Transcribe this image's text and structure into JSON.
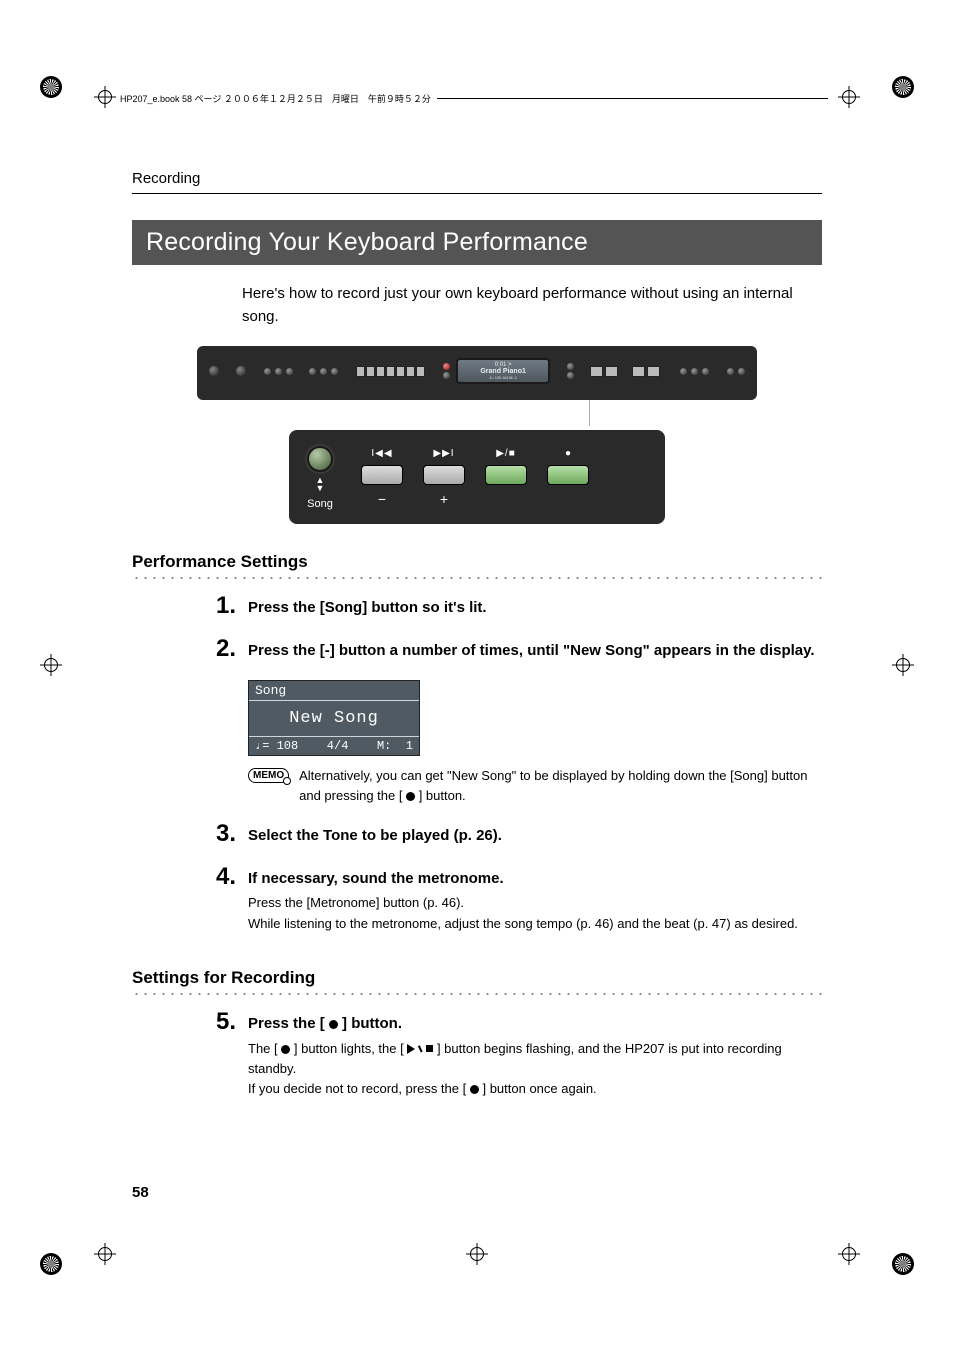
{
  "bookbar": {
    "info": "HP207_e.book 58 ページ ２００６年１２月２５日　月曜日　午前９時５２分"
  },
  "running_head": "Recording",
  "section_title": "Recording Your Keyboard Performance",
  "intro": "Here's how to record just your own keyboard performance without using an internal song.",
  "device": {
    "screen_line1": "0:01   >",
    "screen_line2": "Grand Piano1",
    "screen_line3": "J= 120       4/4   M:     1",
    "song_label": "Song"
  },
  "sub1": "Performance Settings",
  "steps_a": [
    {
      "n": "1",
      "title": "Press the [Song] button so it's lit."
    },
    {
      "n": "2",
      "title": "Press the [-] button a number of times, until \"New Song\" appears in the display."
    }
  ],
  "lcd": {
    "top": "Song",
    "mid": "New Song",
    "tempo": "♩= 108",
    "sig": "4/4",
    "meas_lbl": "M:",
    "meas": "1"
  },
  "memo": {
    "badge": "MEMO",
    "text_a": "Alternatively, you can get \"New Song\" to be displayed by holding down the [Song] button and pressing the [ ",
    "text_b": " ] button."
  },
  "steps_b": [
    {
      "n": "3",
      "title": "Select the Tone to be played (p. 26)."
    },
    {
      "n": "4",
      "title": "If necessary, sound the metronome.",
      "detail_a": "Press the [Metronome] button (p. 46).",
      "detail_b": "While listening to the metronome, adjust the song tempo (p. 46) and the beat (p. 47) as desired."
    }
  ],
  "sub2": "Settings for Recording",
  "step5": {
    "n": "5",
    "title_a": "Press the [ ",
    "title_b": " ] button.",
    "detail_a_1": "The [ ",
    "detail_a_2": " ] button lights, the [ ",
    "detail_a_3": " ] button begins flashing, and the HP207 is put into recording standby.",
    "detail_b_1": "If you decide not to record, press the [ ",
    "detail_b_2": " ] button once again."
  },
  "page_number": "58"
}
